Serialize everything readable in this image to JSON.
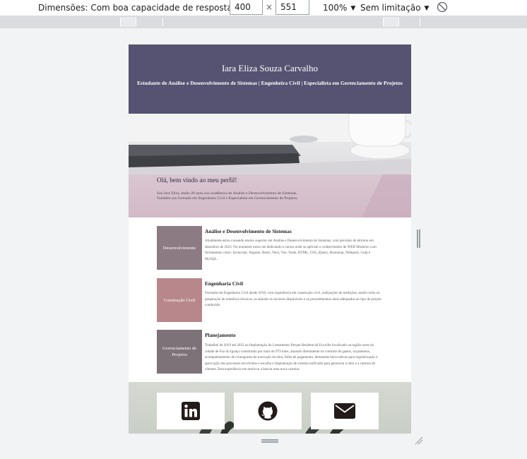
{
  "devtools": {
    "dimensions_label": "Dimensões: Com boa capacidade de resposta",
    "width": "400",
    "height": "551",
    "zoom": "100%",
    "throttling": "Sem limitação"
  },
  "profile": {
    "name": "Iara Eliza Souza Carvalho",
    "subtitle": "Estudante de Análise e Desenvolvimento de Sistemas | Engenheira Civil | Especialista em Gerenciamento de Projetos"
  },
  "intro": {
    "title": "Olá, bem vindo ao meu perfil!",
    "text": "Sou Iara Eliza, tenho 26 anos sou acadêmica de Análise e Desenvolvimento de Sistemas. Também sou formada em Engenharia Civil e Especialista em Gerenciamento de Projetos."
  },
  "cards": [
    {
      "image_label": "Desenvolvimento",
      "title": "Análise e Desenvolvimento de Sistemas",
      "text": "Atualmente estou cursando ensino superior em Análise e Desenvolvimento de Sistemas, com previsão de término em dezembro de 2023. No momento estou me dedicando a cursos onde se aplicam o conhecimento de WEB Moderno com ferramentas como: Javascript, Angular, React, Next, Vue, Node, HTML, CSS, jQuery, Bootstrap, Webpack, Gulp e MySQL.",
      "color": "#8c7b83"
    },
    {
      "image_label": "Construção Civil",
      "title": "Engenharia Civil",
      "text": "Formada em Engenharia Civil desde 2018, com experiência em construção civil, realizações de medições, assim como na preparação de relatórios técnicos, as aliando os recursos disponíveis e os procedimentos mais adequados ao tipo de projeto conduzido.",
      "color": "#b8878c"
    },
    {
      "image_label": "Gerenciamento de Projetos",
      "title": "Planejamento",
      "text": "Trabalhei de 2019 até 2022 na Implantação do Loteamento Parque Residencial Ecoville localizado na região norte da cidade de Foz do Iguaçu constituído por mais de 979 lotes, atuando diretamente no controle de gastos, orçamentos, acompanhamento de cronograma de execução da obra, folha de pagamento, demandas burocráticas para regularização e aprovação dos processos envolvidos e escolha e Implantação de sistema unificado para gerenciar a obra e a carteira de clientes. Esta experiência me motivou a buscar uma nova carreira",
      "color": "#7d7278"
    }
  ],
  "social": [
    {
      "icon": "linkedin-icon"
    },
    {
      "icon": "github-icon"
    },
    {
      "icon": "email-icon"
    }
  ],
  "colors": {
    "header_bg": "#555371",
    "footer_bg": "#cfd4cc",
    "icon": "#231a1a"
  }
}
